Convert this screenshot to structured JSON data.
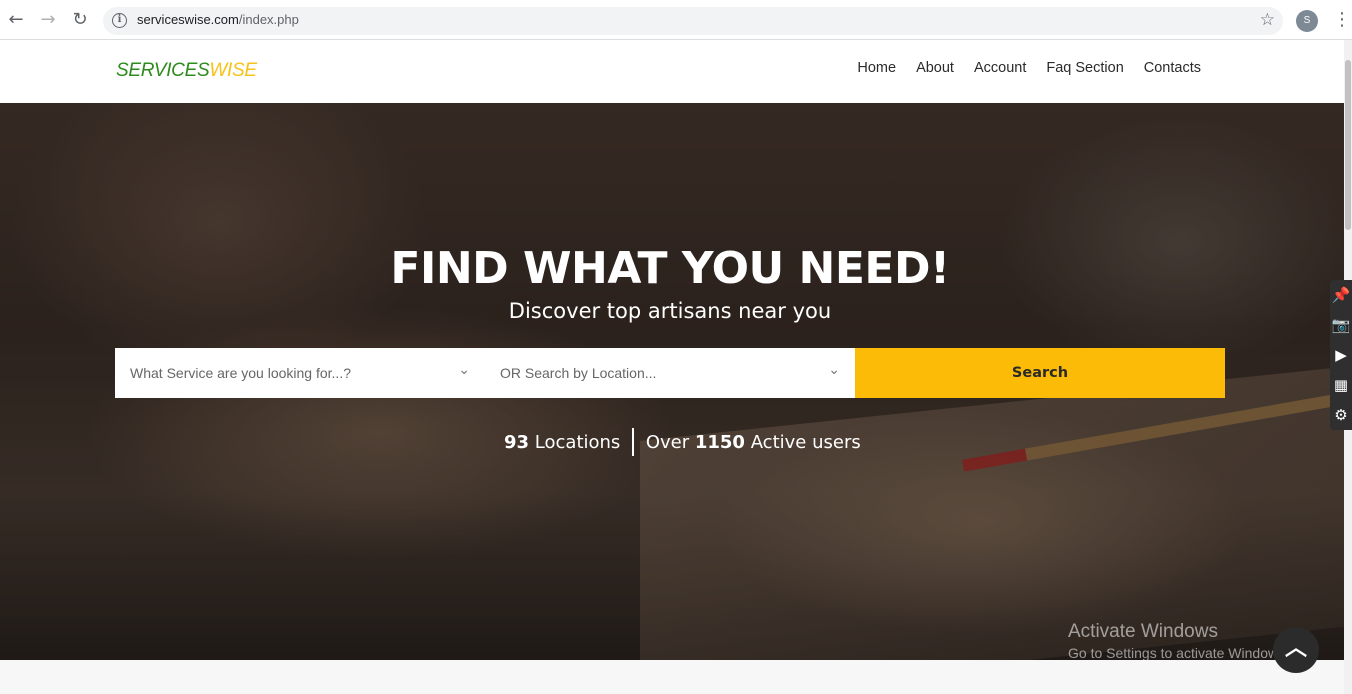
{
  "browser": {
    "url_domain": "serviceswise.com",
    "url_path": "/index.php",
    "profile_initial": "S"
  },
  "site": {
    "logo_part1": "SERVICES",
    "logo_part2": "WISE",
    "nav": [
      "Home",
      "About",
      "Account",
      "Faq Section",
      "Contacts"
    ]
  },
  "hero": {
    "title": "FIND WHAT YOU NEED!",
    "subtitle": "Discover top artisans near you",
    "search": {
      "service_placeholder": "What Service are you looking for...?",
      "location_placeholder": "OR Search by Location...",
      "button_label": "Search"
    },
    "stats": {
      "locations_count": "93",
      "locations_label": "Locations",
      "users_prefix": "Over",
      "users_count": "1150",
      "users_label": "Active users"
    }
  },
  "watermark": {
    "line1": "Activate Windows",
    "line2": "Go to Settings to activate Windows."
  },
  "colors": {
    "logo_green": "#2e8b1e",
    "logo_yellow": "#f6c21b",
    "search_button": "#fbbb06"
  }
}
